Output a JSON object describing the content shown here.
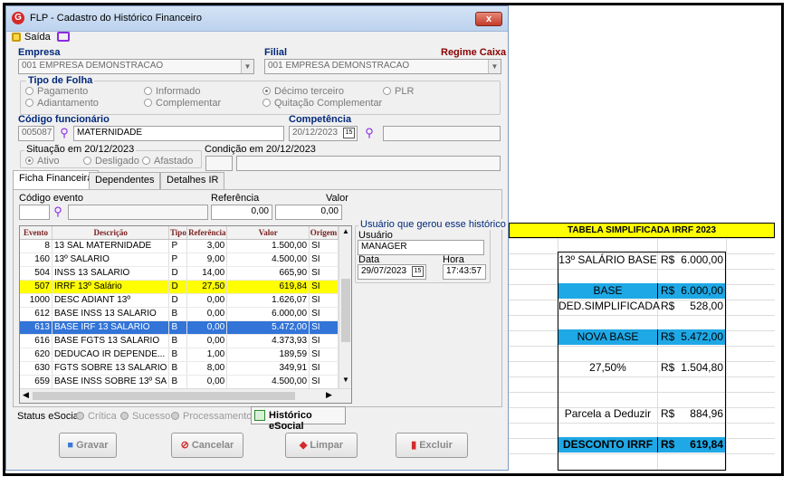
{
  "window": {
    "title": "FLP - Cadastro do Histórico Financeiro",
    "logo": "G",
    "close": "x"
  },
  "toolbar": {
    "exit_label": "Saída"
  },
  "empresa": {
    "label": "Empresa",
    "value": "001 EMPRESA DEMONSTRACAO"
  },
  "filial": {
    "label": "Filial",
    "value": "001 EMPRESA DEMONSTRACAO",
    "regime": "Regime Caixa"
  },
  "tipo_folha": {
    "label": "Tipo de Folha",
    "options": [
      "Pagamento",
      "Informado",
      "Décimo terceiro",
      "PLR",
      "Adiantamento",
      "Complementar",
      "Quitação Complementar"
    ],
    "selected": "Décimo terceiro"
  },
  "funcionario": {
    "label": "Código funcionário",
    "code": "005087",
    "name": "MATERNIDADE"
  },
  "competencia": {
    "label": "Competência",
    "value": "20/12/2023"
  },
  "situacao": {
    "label": "Situação em 20/12/2023",
    "options": [
      "Ativo",
      "Desligado",
      "Afastado"
    ],
    "selected": "Ativo"
  },
  "condicao": {
    "label": "Condição em 20/12/2023"
  },
  "tabs": [
    "Ficha Financeira",
    "Dependentes",
    "Detalhes IR"
  ],
  "evento_inputs": {
    "codigo_label": "Código evento",
    "referencia_label": "Referência",
    "referencia_value": "0,00",
    "valor_label": "Valor",
    "valor_value": "0,00"
  },
  "grid": {
    "headers": [
      "Evento",
      "Descrição",
      "Tipo",
      "Referência",
      "Valor",
      "Origem"
    ],
    "rows": [
      [
        "8",
        "13 SAL MATERNIDADE",
        "P",
        "3,00",
        "1.500,00",
        "SI"
      ],
      [
        "160",
        "13º SALARIO",
        "P",
        "9,00",
        "4.500,00",
        "SI"
      ],
      [
        "504",
        "INSS 13 SALARIO",
        "D",
        "14,00",
        "665,90",
        "SI"
      ],
      [
        "507",
        "IRRF 13º Salário",
        "D",
        "27,50",
        "619,84",
        "SI"
      ],
      [
        "1000",
        "DESC ADIANT 13º",
        "D",
        "0,00",
        "1.626,07",
        "SI"
      ],
      [
        "612",
        "BASE INSS 13 SALARIO",
        "B",
        "0,00",
        "6.000,00",
        "SI"
      ],
      [
        "613",
        "BASE IRF 13 SALARIO",
        "B",
        "0,00",
        "5.472,00",
        "SI"
      ],
      [
        "616",
        "BASE FGTS 13 SALARIO",
        "B",
        "0,00",
        "4.373,93",
        "SI"
      ],
      [
        "620",
        "DEDUCAO IR DEPENDE...",
        "B",
        "1,00",
        "189,59",
        "SI"
      ],
      [
        "630",
        "FGTS SOBRE 13 SALARIO",
        "B",
        "8,00",
        "349,91",
        "SI"
      ],
      [
        "659",
        "BASE INSS SOBRE 13º SA",
        "B",
        "0,00",
        "4.500,00",
        "SI"
      ]
    ],
    "highlight_yellow_index": 3,
    "highlight_blue_index": 6
  },
  "usuario_box": {
    "title": "Usuário que gerou esse histórico",
    "usuario_label": "Usuário",
    "usuario_value": "MANAGER",
    "data_label": "Data",
    "data_value": "29/07/2023",
    "hora_label": "Hora",
    "hora_value": "17:43:57"
  },
  "status": {
    "label": "Status eSocial:",
    "items": [
      "Crítica",
      "Sucesso",
      "Processamento"
    ],
    "historico_button": "Histórico eSocial"
  },
  "buttons": {
    "gravar": "Gravar",
    "cancelar": "Cancelar",
    "limpar": "Limpar",
    "excluir": "Excluir"
  },
  "sheet": {
    "title": "TABELA SIMPLIFICADA IRRF 2023",
    "rows": [
      {
        "label": "13º SALÁRIO BASE",
        "currency": "R$",
        "value": "6.000,00",
        "blue": false
      },
      {
        "label": "",
        "currency": "",
        "value": "",
        "blue": false
      },
      {
        "label": "BASE",
        "currency": "R$",
        "value": "6.000,00",
        "blue": true
      },
      {
        "label": "DED.SIMPLIFICADA",
        "currency": "R$",
        "value": "528,00",
        "blue": false
      },
      {
        "label": "",
        "currency": "",
        "value": "",
        "blue": false
      },
      {
        "label": "NOVA BASE",
        "currency": "R$",
        "value": "5.472,00",
        "blue": true
      },
      {
        "label": "",
        "currency": "",
        "value": "",
        "blue": false
      },
      {
        "label": "27,50%",
        "currency": "R$",
        "value": "1.504,80",
        "blue": false
      },
      {
        "label": "",
        "currency": "",
        "value": "",
        "blue": false
      },
      {
        "label": "",
        "currency": "",
        "value": "",
        "blue": false
      },
      {
        "label": "Parcela a Deduzir",
        "currency": "R$",
        "value": "884,96",
        "blue": false
      },
      {
        "label": "",
        "currency": "",
        "value": "",
        "blue": false
      },
      {
        "label": "DESCONTO IRRF",
        "currency": "R$",
        "value": "619,84",
        "blue": true
      }
    ]
  },
  "colors": {
    "highlight_yellow": "#ffff00",
    "selected_blue": "#3274d8",
    "sheet_blue": "#1fa8e6",
    "label_navy": "#00287a",
    "regime_red": "#8b0000"
  }
}
